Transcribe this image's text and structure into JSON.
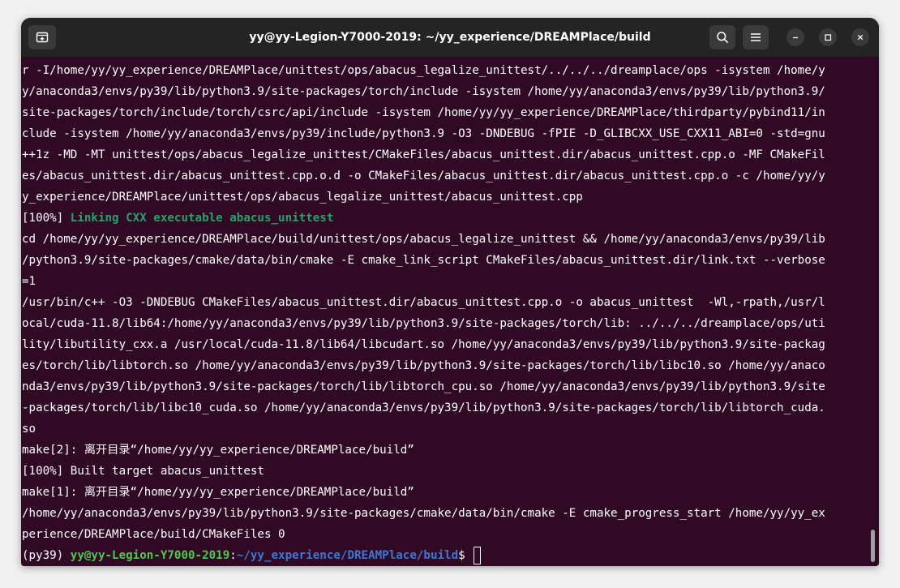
{
  "window": {
    "title": "yy@yy-Legion-Y7000-2019: ~/yy_experience/DREAMPlace/build"
  },
  "icons": {
    "new_tab": "new-tab-icon",
    "search": "search-icon",
    "menu": "hamburger-menu-icon",
    "minimize": "minimize-icon",
    "maximize": "maximize-icon",
    "close": "close-icon"
  },
  "colors": {
    "terminal_bg": "#300a24",
    "titlebar_bg": "#242424",
    "green": "#26a269",
    "prompt_green": "#4ec94e",
    "prompt_blue": "#3b78d8"
  },
  "terminal": {
    "lines": [
      "r -I/home/yy/yy_experience/DREAMPlace/unittest/ops/abacus_legalize_unittest/../../../dreamplace/ops -isystem /home/y",
      "y/anaconda3/envs/py39/lib/python3.9/site-packages/torch/include -isystem /home/yy/anaconda3/envs/py39/lib/python3.9/",
      "site-packages/torch/include/torch/csrc/api/include -isystem /home/yy/yy_experience/DREAMPlace/thirdparty/pybind11/in",
      "clude -isystem /home/yy/anaconda3/envs/py39/include/python3.9 -O3 -DNDEBUG -fPIE -D_GLIBCXX_USE_CXX11_ABI=0 -std=gnu",
      "++1z -MD -MT unittest/ops/abacus_legalize_unittest/CMakeFiles/abacus_unittest.dir/abacus_unittest.cpp.o -MF CMakeFil",
      "es/abacus_unittest.dir/abacus_unittest.cpp.o.d -o CMakeFiles/abacus_unittest.dir/abacus_unittest.cpp.o -c /home/yy/y",
      "y_experience/DREAMPlace/unittest/ops/abacus_legalize_unittest/abacus_unittest.cpp"
    ],
    "link_line": {
      "prefix": "[100%] ",
      "message": "Linking CXX executable abacus_unittest"
    },
    "lines2": [
      "cd /home/yy/yy_experience/DREAMPlace/build/unittest/ops/abacus_legalize_unittest && /home/yy/anaconda3/envs/py39/lib",
      "/python3.9/site-packages/cmake/data/bin/cmake -E cmake_link_script CMakeFiles/abacus_unittest.dir/link.txt --verbose",
      "=1",
      "/usr/bin/c++ -O3 -DNDEBUG CMakeFiles/abacus_unittest.dir/abacus_unittest.cpp.o -o abacus_unittest  -Wl,-rpath,/usr/l",
      "ocal/cuda-11.8/lib64:/home/yy/anaconda3/envs/py39/lib/python3.9/site-packages/torch/lib: ../../../dreamplace/ops/uti",
      "lity/libutility_cxx.a /usr/local/cuda-11.8/lib64/libcudart.so /home/yy/anaconda3/envs/py39/lib/python3.9/site-packag",
      "es/torch/lib/libtorch.so /home/yy/anaconda3/envs/py39/lib/python3.9/site-packages/torch/lib/libc10.so /home/yy/anaco",
      "nda3/envs/py39/lib/python3.9/site-packages/torch/lib/libtorch_cpu.so /home/yy/anaconda3/envs/py39/lib/python3.9/site",
      "-packages/torch/lib/libc10_cuda.so /home/yy/anaconda3/envs/py39/lib/python3.9/site-packages/torch/lib/libtorch_cuda.",
      "so",
      "make[2]: 离开目录“/home/yy/yy_experience/DREAMPlace/build”",
      "[100%] Built target abacus_unittest",
      "make[1]: 离开目录“/home/yy/yy_experience/DREAMPlace/build”",
      "/home/yy/anaconda3/envs/py39/lib/python3.9/site-packages/cmake/data/bin/cmake -E cmake_progress_start /home/yy/yy_ex",
      "perience/DREAMPlace/build/CMakeFiles 0"
    ],
    "prompt": {
      "env": "(py39) ",
      "user_host": "yy@yy-Legion-Y7000-2019",
      "colon": ":",
      "path": "~/yy_experience/DREAMPlace/build",
      "dollar": "$"
    }
  }
}
